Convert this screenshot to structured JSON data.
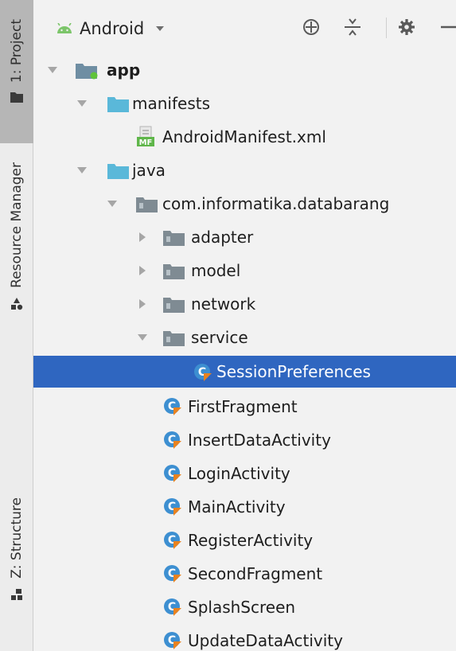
{
  "sidebar": {
    "project_tab": "1: Project",
    "resource_tab": "Resource Manager",
    "structure_tab": "Z: Structure"
  },
  "header": {
    "view_label": "Android"
  },
  "tree": {
    "app": "app",
    "manifests": "manifests",
    "android_manifest": "AndroidManifest.xml",
    "java": "java",
    "package": "com.informatika.databarang",
    "adapter": "adapter",
    "model": "model",
    "network": "network",
    "service": "service",
    "session_preferences": "SessionPreferences",
    "classes": [
      "FirstFragment",
      "InsertDataActivity",
      "LoginActivity",
      "MainActivity",
      "RegisterActivity",
      "SecondFragment",
      "SplashScreen",
      "UpdateDataActivity"
    ]
  },
  "colors": {
    "selection": "#2f66c0",
    "folder": "#5ab8d9",
    "android_green": "#7cc56a",
    "class_icon": "#3d8fd1"
  }
}
